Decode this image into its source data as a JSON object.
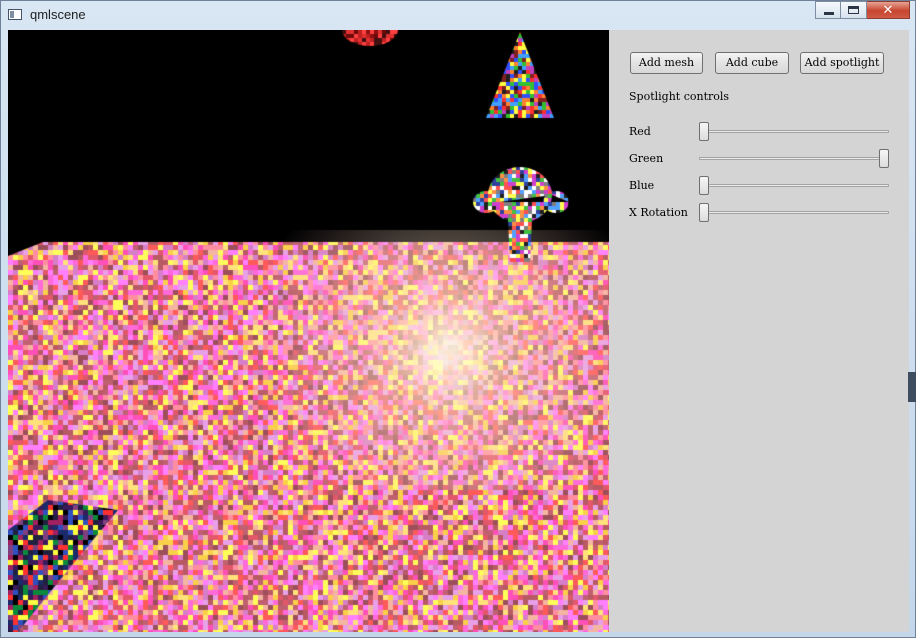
{
  "window": {
    "title": "qmlscene",
    "caption_buttons": [
      "minimize",
      "maximize",
      "close"
    ],
    "close_glyph": "✕"
  },
  "scene": {
    "background": "#000000",
    "objects": [
      "sphere",
      "cone",
      "monkey-head-mesh",
      "textured-floor-cube"
    ]
  },
  "panel": {
    "buttons": [
      {
        "label": "Add mesh"
      },
      {
        "label": "Add cube"
      },
      {
        "label": "Add spotlight"
      }
    ],
    "section_title": "Spotlight controls",
    "sliders": [
      {
        "label": "Red",
        "value": 0.0
      },
      {
        "label": "Green",
        "value": 1.0
      },
      {
        "label": "Blue",
        "value": 0.0
      },
      {
        "label": "X Rotation",
        "value": 0.0
      }
    ]
  }
}
